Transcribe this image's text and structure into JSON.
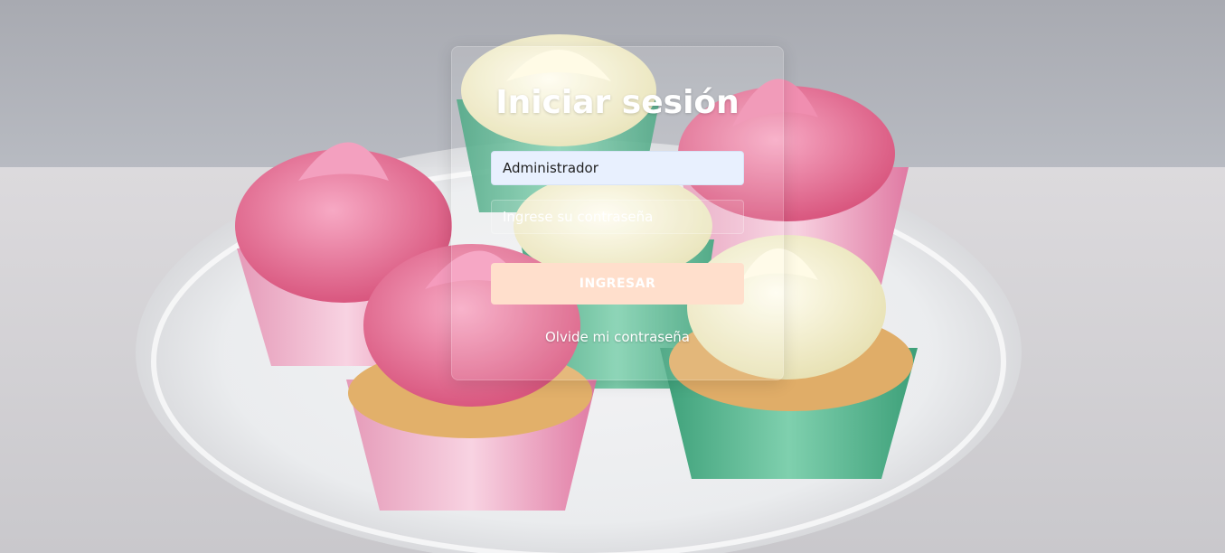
{
  "login": {
    "title": "Iniciar sesión",
    "username_value": "Administrador",
    "password_placeholder": "Ingrese su contraseña",
    "submit_label": "INGRESAR",
    "forgot_link": "Olvide mi contraseña"
  },
  "colors": {
    "submit_button": "#ffdfcc",
    "username_field": "#e8f0fe",
    "text_on_card": "#ffffff"
  },
  "background": {
    "subject": "cupcakes-on-cake-stand"
  }
}
